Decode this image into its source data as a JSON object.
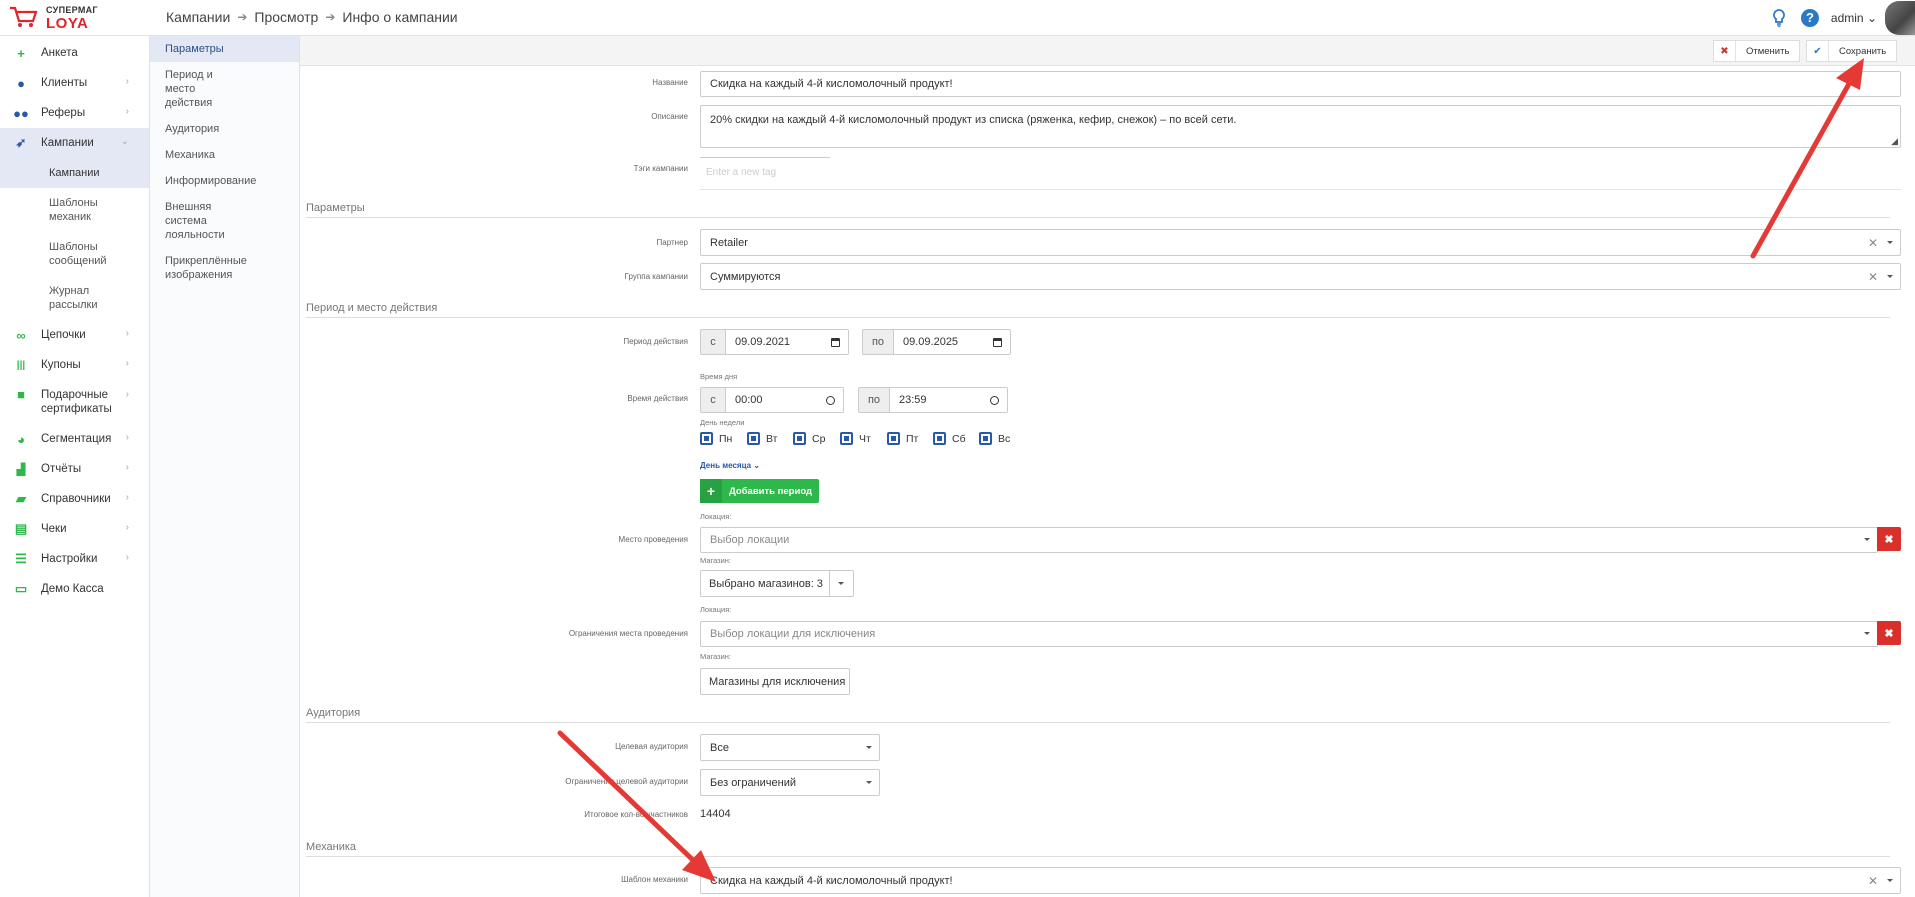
{
  "app": {
    "logo_top": "СУПЕРМАГ",
    "logo_bottom": "LOYA",
    "accent": "#e2232a"
  },
  "breadcrumb": [
    "Кампании",
    "Просмотр",
    "Инфо о кампании"
  ],
  "user": {
    "name": "admin"
  },
  "sidebar": {
    "items": [
      {
        "label": "Анкета",
        "icon": "plus-icon",
        "color": "#2eb84b"
      },
      {
        "label": "Клиенты",
        "icon": "user-icon",
        "color": "#2859a8"
      },
      {
        "label": "Реферы",
        "icon": "users-icon",
        "color": "#2859a8"
      },
      {
        "label": "Кампании",
        "icon": "rocket-icon",
        "color": "#2859a8"
      },
      {
        "label": "Цепочки",
        "icon": "chain-icon",
        "color": "#2eb84b"
      },
      {
        "label": "Купоны",
        "icon": "barcode-icon",
        "color": "#2eb84b"
      },
      {
        "label": "Подарочные сертификаты",
        "icon": "gift-icon",
        "color": "#2eb84b"
      },
      {
        "label": "Сегментация",
        "icon": "pie-chart-icon",
        "color": "#2eb84b"
      },
      {
        "label": "Отчёты",
        "icon": "bar-chart-icon",
        "color": "#2eb84b"
      },
      {
        "label": "Справочники",
        "icon": "book-icon",
        "color": "#2eb84b"
      },
      {
        "label": "Чеки",
        "icon": "receipt-icon",
        "color": "#2eb84b"
      },
      {
        "label": "Настройки",
        "icon": "sliders-icon",
        "color": "#2eb84b"
      },
      {
        "label": "Демо Касса",
        "icon": "laptop-icon",
        "color": "#2eb84b"
      }
    ],
    "sub": [
      "Кампании",
      "Шаблоны механик",
      "Шаблоны сообщений",
      "Журнал рассылки"
    ]
  },
  "tabs": [
    "Параметры",
    "Период и место действия",
    "Аудитория",
    "Механика",
    "Информирование",
    "Внешняя система лояльности",
    "Прикреплённые изображения"
  ],
  "actions": {
    "cancel": "Отменить",
    "save": "Сохранить"
  },
  "form": {
    "name_label": "Название",
    "name_value": "Скидка на каждый 4-й кисломолочный продукт!",
    "desc_label": "Описание",
    "desc_value": "20% скидки на каждый 4-й кисломолочный продукт из списка (ряженка, кефир, снежок) – по всей сети.",
    "tags_label": "Тэги кампании",
    "tags_placeholder": "Enter a new tag",
    "sec_params": "Параметры",
    "partner_label": "Партнер",
    "partner_value": "Retailer",
    "group_label": "Группа кампании",
    "group_value": "Суммируются",
    "sec_period": "Период и место действия",
    "period_label": "Период действия",
    "from": "с",
    "to": "по",
    "date_from": "09.09.2021",
    "date_to": "09.09.2025",
    "time_of_day": "Время дня",
    "time_label": "Время действия",
    "time_from": "00:00",
    "time_to": "23:59",
    "weekday_label": "День недели",
    "days": [
      "Пн",
      "Вт",
      "Ср",
      "Чт",
      "Пт",
      "Сб",
      "Вс"
    ],
    "month_day": "День месяца",
    "add_period": "Добавить период",
    "location_label": "Локация:",
    "place_label": "Место проведения",
    "place_placeholder": "Выбор локации",
    "store_label": "Магазин:",
    "stores_selected": "Выбрано магазинов: 3",
    "restrict_label": "Ограничения места проведения",
    "restrict_placeholder": "Выбор локации для исключения",
    "exclude_stores": "Магазины для исключения",
    "sec_audience": "Аудитория",
    "target_label": "Целевая аудитория",
    "target_value": "Все",
    "target_restrict_label": "Ограничения целевой аудитории",
    "target_restrict_value": "Без ограничений",
    "total_label": "Итоговое кол-во участников",
    "total_value": "14404",
    "sec_mechanics": "Механика",
    "template_label": "Шаблон механики",
    "template_value": "Скидка на каждый 4-й кисломолочный продукт!"
  }
}
